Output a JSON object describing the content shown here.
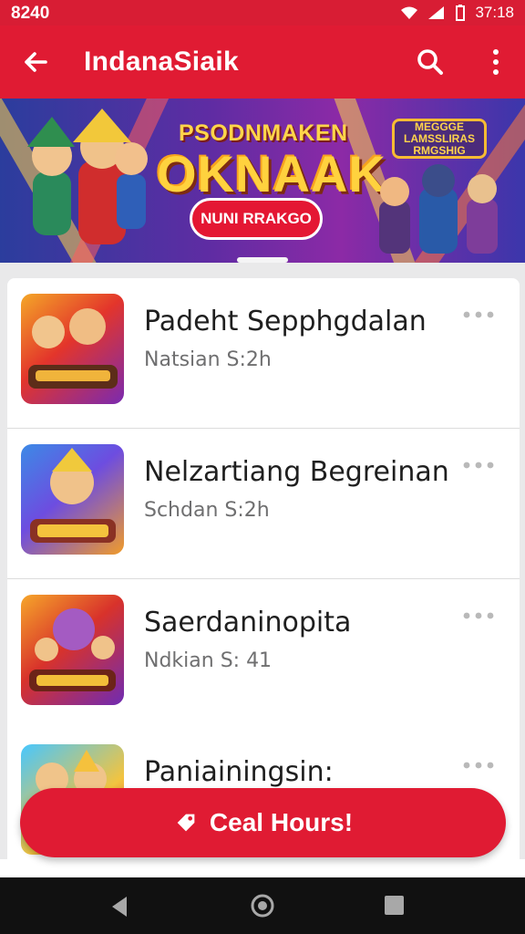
{
  "status_bar": {
    "time": "8240",
    "right_text": "37:18",
    "icons": [
      "wifi-icon",
      "signal-icon",
      "battery-icon"
    ]
  },
  "app_bar": {
    "title": "IndanaSiaik",
    "back_icon": "arrow-left-icon",
    "search_icon": "search-icon",
    "more_icon": "more-vert-icon",
    "color": "#e01b33"
  },
  "banner": {
    "kicker": "PSODNMAKEN",
    "headline": "OKNAAK",
    "cta": "NUNI RRAKGO",
    "badge": "MEGGGE\nLAMSSLIRAS\nRMGSHIG"
  },
  "list": {
    "items": [
      {
        "title": "Padeht Sepphgdalan",
        "meta": "Natsian  S:2h"
      },
      {
        "title": "Nelzartiang Begreinan",
        "meta": "Schdan  S:2h"
      },
      {
        "title": "Saerdaninopita",
        "meta": "Ndkian  S: 41"
      },
      {
        "title": "Paniainingsin:",
        "meta": ""
      }
    ]
  },
  "cta": {
    "label": "Ceal Hours!",
    "icon": "tag-icon"
  },
  "colors": {
    "primary": "#e01b33",
    "background": "#e9e9ea",
    "card": "#ffffff"
  }
}
